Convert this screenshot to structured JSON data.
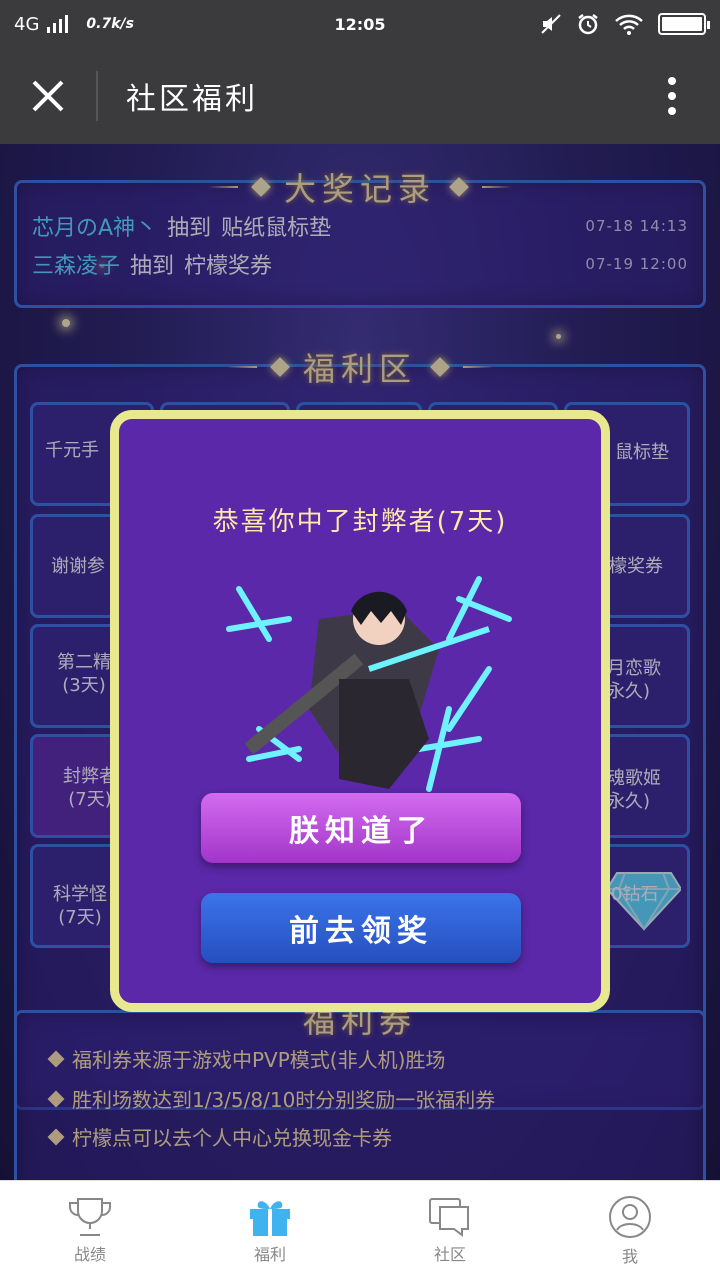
{
  "status_bar": {
    "network": "4G",
    "speed": "0.7k/s",
    "time": "12:05",
    "battery_level": 1.0
  },
  "nav": {
    "title": "社区福利",
    "close_icon": "close-icon",
    "more_icon": "more-vert-icon"
  },
  "prize_records": {
    "title": "大奖记录",
    "items": [
      {
        "user": "芯月のA神丶",
        "verb": "抽到",
        "prize": "贴纸鼠标垫",
        "time": "07-18 14:13"
      },
      {
        "user": "三森凌子",
        "verb": "抽到",
        "prize": "柠檬奖券",
        "time": "07-19 12:00"
      }
    ]
  },
  "welfare_zone": {
    "title": "福利区",
    "tiles_left": [
      {
        "label": "千元手"
      },
      {
        "label": "谢谢参"
      },
      {
        "label": "第二精\n(3天)"
      },
      {
        "label": "封弊者\n(7天)"
      },
      {
        "label": "科学怪\n(7天)"
      }
    ],
    "tiles_right": [
      {
        "label": "鼠标垫"
      },
      {
        "label": "檬奖券"
      },
      {
        "label": "月恋歌\n永久)"
      },
      {
        "label": "魂歌姬\n永久)"
      },
      {
        "label": "0钻石"
      }
    ]
  },
  "coupon": {
    "title": "福利券",
    "rules": [
      "福利券来源于游戏中PVP模式(非人机)胜场",
      "胜利场数达到1/3/5/8/10时分别奖励一张福利券",
      "柠檬点可以去个人中心兑换现金卡券"
    ]
  },
  "modal": {
    "message": "恭喜你中了封弊者(7天)",
    "ok_button": "朕知道了",
    "claim_button": "前去领奖"
  },
  "tabbar": {
    "items": [
      {
        "label": "战绩",
        "icon": "trophy-icon"
      },
      {
        "label": "福利",
        "icon": "gift-icon"
      },
      {
        "label": "社区",
        "icon": "chat-icon"
      },
      {
        "label": "我",
        "icon": "user-icon"
      }
    ]
  },
  "colors": {
    "accent_blue": "#3b73e0",
    "gold": "#ffe9a8",
    "cyan_user": "#5de2ff",
    "modal_purple": "#5a28a8",
    "tab_active": "#3fb3ef"
  }
}
